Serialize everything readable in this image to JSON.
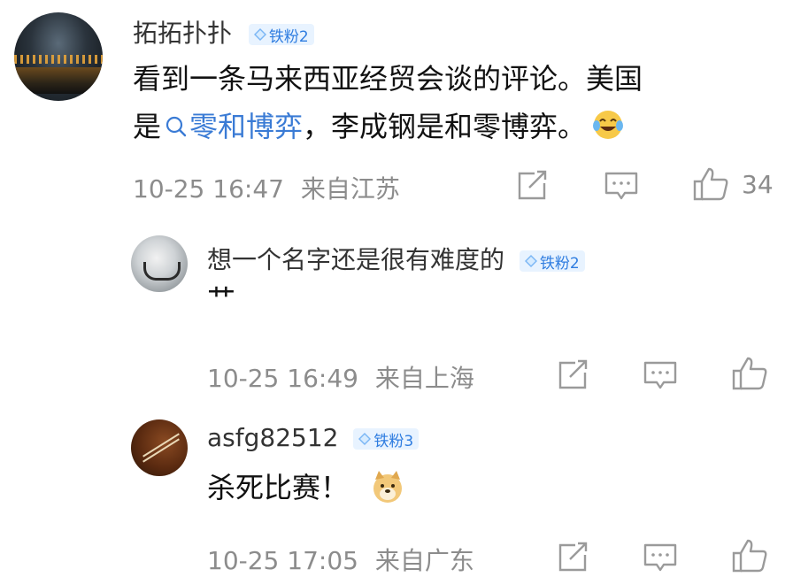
{
  "main_comment": {
    "username": "拓拓扑扑",
    "badge": "铁粉2",
    "text_line1": "看到一条马来西亚经贸会谈的评论。美国",
    "text_line2_prefix": "是",
    "topic": "零和博弈",
    "text_line2_rest": "，李成钢是和零博弈。",
    "emoji": "laughing-tears-emoji",
    "date": "10-25 16:47",
    "location": "来自江苏",
    "like_count": "34"
  },
  "replies": [
    {
      "username": "想一个名字还是很有难度的",
      "badge": "铁粉2",
      "text": "艹",
      "date": "10-25 16:49",
      "location": "来自上海"
    },
    {
      "username": "asfg82512",
      "badge": "铁粉3",
      "text": "杀死比赛！",
      "emoji": "doge-emoji",
      "date": "10-25 17:05",
      "location": "来自广东"
    }
  ],
  "icons": {
    "share": "share-icon",
    "comment": "comment-icon",
    "like": "like-icon",
    "search": "search-icon"
  },
  "colors": {
    "topic_link": "#3a7bd5",
    "badge_bg": "#e8f3ff",
    "badge_text": "#2f7de0",
    "meta_text": "#8c8c8c"
  }
}
